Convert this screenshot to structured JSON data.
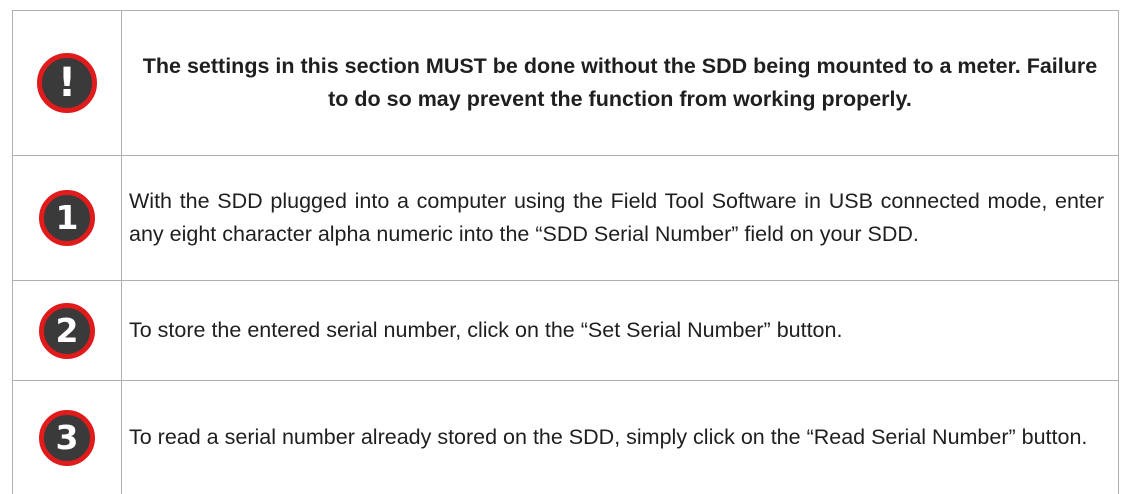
{
  "warning": {
    "icon": "exclamation-icon",
    "symbol": "!",
    "text": "The settings in this section MUST be done without the SDD being mounted to a meter. Failure to do so may prevent the function from working properly."
  },
  "steps": [
    {
      "number": "1",
      "icon": "step-1-icon",
      "text": "With the SDD plugged into a computer using the Field Tool Software in USB connected mode, enter any eight character alpha numeric into the “SDD Serial Number” field on your SDD."
    },
    {
      "number": "2",
      "icon": "step-2-icon",
      "text": "To store the entered serial number, click on the “Set Serial Number” button."
    },
    {
      "number": "3",
      "icon": "step-3-icon",
      "text": "To read a serial number already stored on the SDD, simply click on the “Read Serial Number” button."
    }
  ],
  "colors": {
    "badge_fill": "#3a3a3a",
    "badge_ring": "#e01b1b",
    "border": "#b0b0b0"
  }
}
